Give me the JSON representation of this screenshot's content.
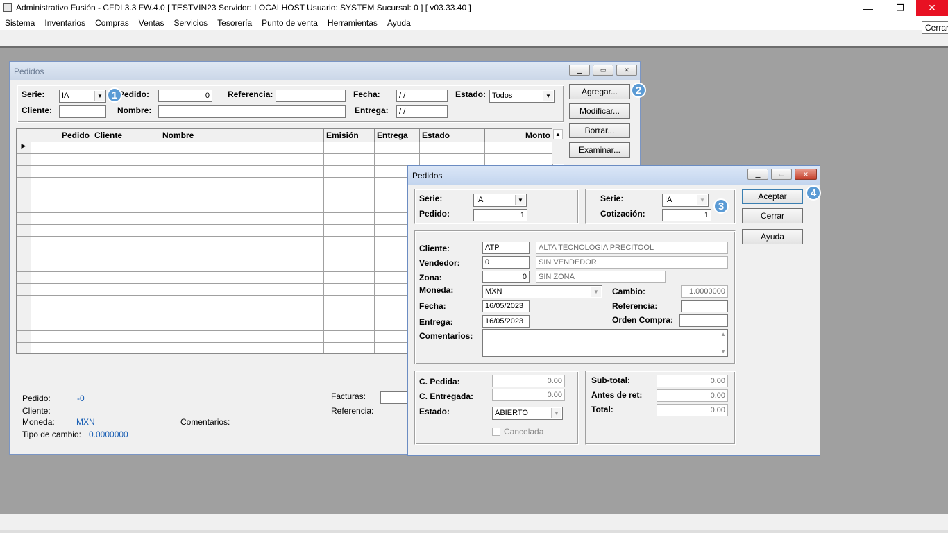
{
  "app": {
    "title": "Administrativo Fusión - CFDI 3.3 FW.4.0 [ TESTVIN23   Servidor: LOCALHOST   Usuario: SYSTEM    Sucursal: 0 ] [ v03.33.40 ]",
    "tooltip": "Cerrar",
    "window_controls": {
      "minimize": "—",
      "maximize": "❐",
      "close": "✕"
    }
  },
  "menu": [
    "Sistema",
    "Inventarios",
    "Compras",
    "Ventas",
    "Servicios",
    "Tesorería",
    "Punto de venta",
    "Herramientas",
    "Ayuda"
  ],
  "list_window": {
    "title": "Pedidos",
    "filters": {
      "serie_label": "Serie:",
      "serie_value": "IA",
      "pedido_label": "Pedido:",
      "pedido_value": "0",
      "referencia_label": "Referencia:",
      "fecha_label": "Fecha:",
      "fecha_value": " / /",
      "estado_label": "Estado:",
      "estado_value": "Todos",
      "cliente_label": "Cliente:",
      "nombre_label": "Nombre:",
      "entrega_label": "Entrega:",
      "entrega_value": " / /"
    },
    "buttons": {
      "agregar": "Agregar...",
      "modificar": "Modificar...",
      "borrar": "Borrar...",
      "examinar": "Examinar..."
    },
    "columns": [
      "Pedido",
      "Cliente",
      "Nombre",
      "Emisión",
      "Entrega",
      "Estado",
      "Monto"
    ],
    "footer": {
      "pedido_label": "Pedido:",
      "pedido_value": "-0",
      "cliente_label": "Cliente:",
      "moneda_label": "Moneda:",
      "moneda_value": "MXN",
      "tipo_cambio_label": "Tipo de cambio:",
      "tipo_cambio_value": "0.0000000",
      "comentarios_label": "Comentarios:",
      "facturas_label": "Facturas:",
      "referencia_label": "Referencia:"
    }
  },
  "badges": [
    "1",
    "2",
    "3",
    "4"
  ],
  "dialog": {
    "title": "Pedidos",
    "serie_label": "Serie:",
    "serie_value": "IA",
    "pedido_label": "Pedido:",
    "pedido_value": "1",
    "serie2_label": "Serie:",
    "serie2_value": "IA",
    "cotizacion_label": "Cotización:",
    "cotizacion_value": "1",
    "buttons": {
      "aceptar": "Aceptar",
      "cerrar": "Cerrar",
      "ayuda": "Ayuda"
    },
    "cliente_label": "Cliente:",
    "cliente_code": "ATP",
    "cliente_name": "ALTA TECNOLOGIA PRECITOOL",
    "vendedor_label": "Vendedor:",
    "vendedor_code": "0",
    "vendedor_name": "SIN VENDEDOR",
    "zona_label": "Zona:",
    "zona_code": "0",
    "zona_name": "SIN ZONA",
    "moneda_label": "Moneda:",
    "moneda_value": "MXN",
    "cambio_label": "Cambio:",
    "cambio_value": "1.0000000",
    "fecha_label": "Fecha:",
    "fecha_value": "16/05/2023",
    "referencia_label": "Referencia:",
    "entrega_label": "Entrega:",
    "entrega_value": "16/05/2023",
    "orden_compra_label": "Orden Compra:",
    "comentarios_label": "Comentarios:",
    "c_pedida_label": "C. Pedida:",
    "c_pedida_value": "0.00",
    "c_entregada_label": "C. Entregada:",
    "c_entregada_value": "0.00",
    "estado_label": "Estado:",
    "estado_value": "ABIERTO",
    "cancelada_label": "Cancelada",
    "subtotal_label": "Sub-total:",
    "subtotal_value": "0.00",
    "antes_ret_label": "Antes de ret:",
    "antes_ret_value": "0.00",
    "total_label": "Total:",
    "total_value": "0.00"
  }
}
